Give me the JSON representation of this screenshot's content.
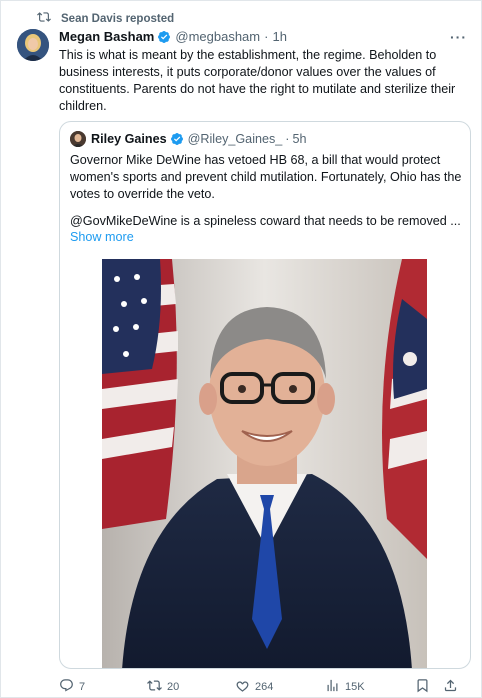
{
  "repost": {
    "text": "Sean Davis reposted",
    "icon": "repost-icon"
  },
  "tweet": {
    "author_name": "Megan Basham",
    "handle": "@megbasham",
    "separator": "·",
    "time": "1h",
    "more": "···",
    "text": "This is what is meant by the establishment, the regime. Beholden to business interests, it puts corporate/donor values over the values of constituents. Parents do not have the right to mutilate and sterilize their children."
  },
  "quote": {
    "author_name": "Riley Gaines",
    "handle": "@Riley_Gaines_",
    "separator": "·",
    "time": "5h",
    "text": "Governor Mike DeWine has vetoed HB 68, a bill that would protect women's sports and prevent child mutilation. Fortunately, Ohio has the votes to override the veto.",
    "text2": "@GovMikeDeWine is a spineless coward that needs to be removed ...",
    "show_more": "Show more"
  },
  "actions": {
    "replies": "7",
    "reposts": "20",
    "likes": "264",
    "views": "15K"
  },
  "colors": {
    "accent": "#1d9bf0",
    "muted": "#536471",
    "text": "#0f1419",
    "repost_active": "#536471"
  }
}
